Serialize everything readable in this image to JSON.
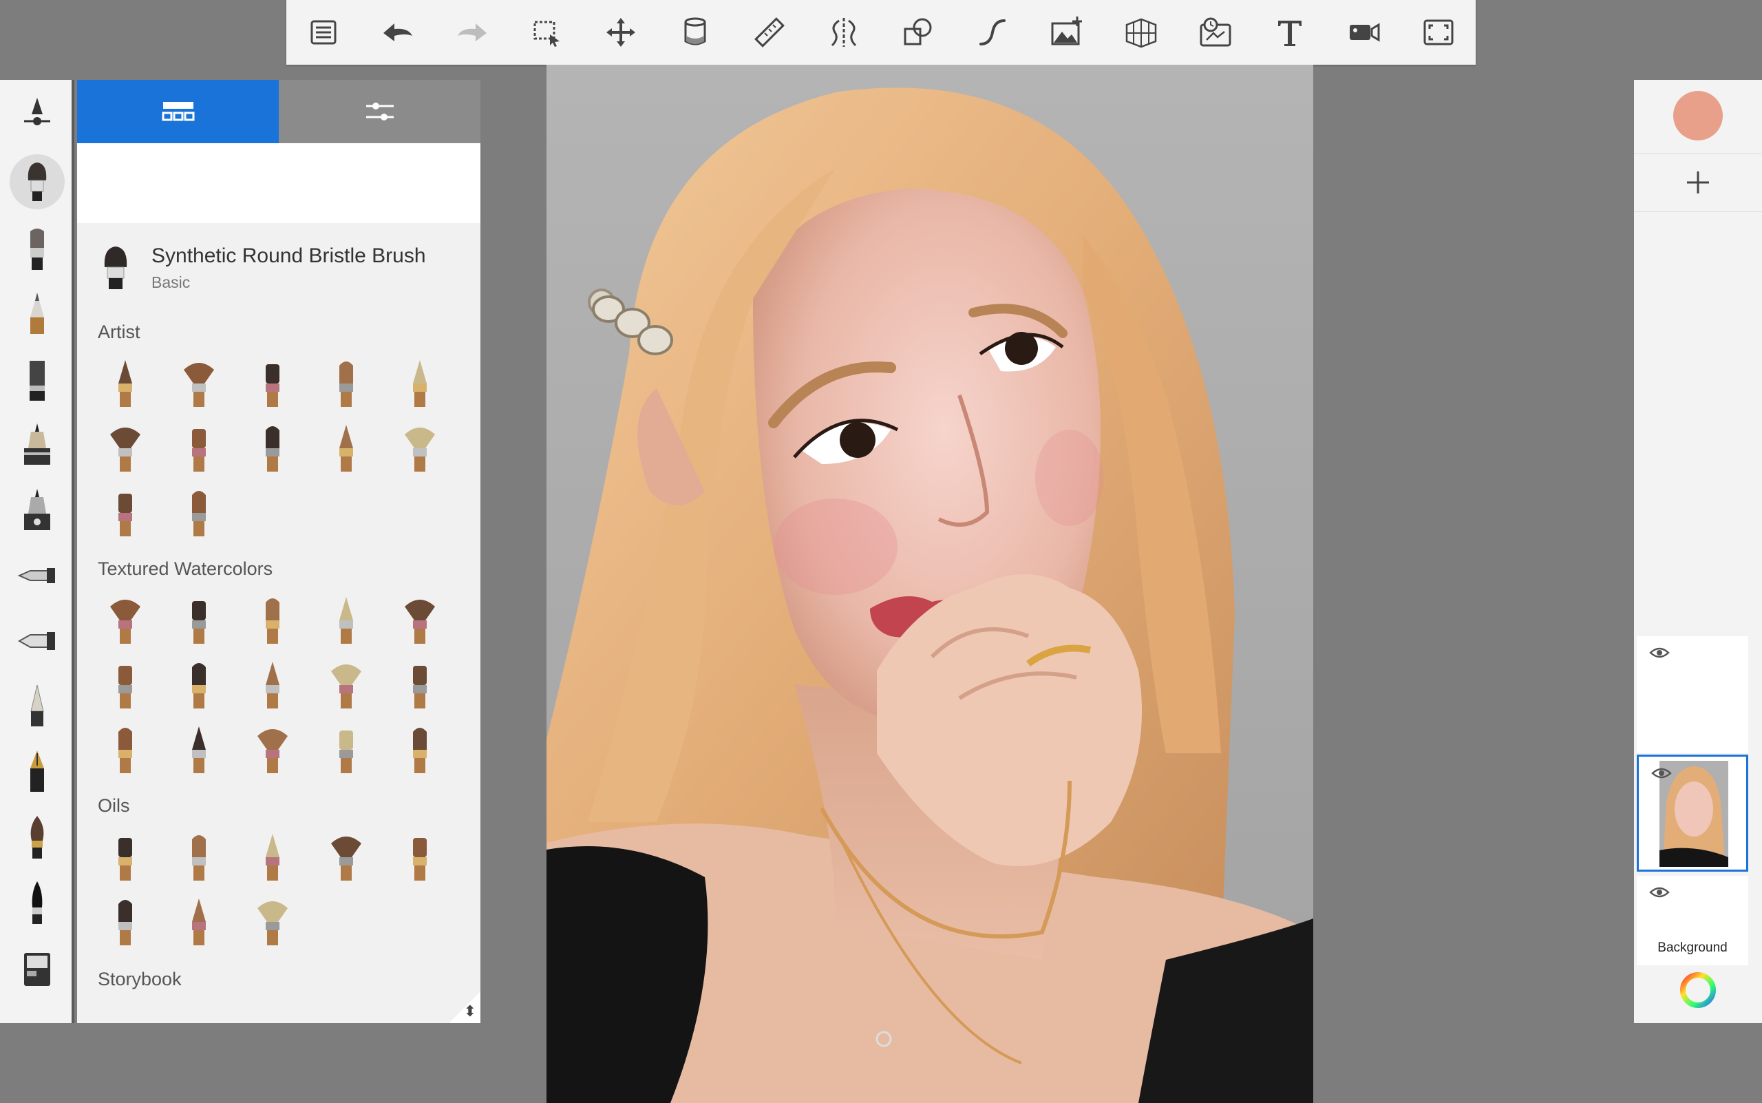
{
  "toolbar": {
    "buttons": [
      {
        "name": "menu-list-button",
        "icon": "list-icon"
      },
      {
        "name": "undo-button",
        "icon": "undo-icon"
      },
      {
        "name": "redo-button",
        "icon": "redo-icon"
      },
      {
        "name": "selection-button",
        "icon": "selection-icon"
      },
      {
        "name": "transform-button",
        "icon": "move-icon"
      },
      {
        "name": "fill-button",
        "icon": "paint-bucket-icon"
      },
      {
        "name": "ruler-button",
        "icon": "ruler-icon"
      },
      {
        "name": "symmetry-button",
        "icon": "symmetry-icon"
      },
      {
        "name": "shapes-button",
        "icon": "shapes-icon"
      },
      {
        "name": "stroke-button",
        "icon": "curve-icon"
      },
      {
        "name": "add-image-button",
        "icon": "image-add-icon"
      },
      {
        "name": "perspective-button",
        "icon": "perspective-grid-icon"
      },
      {
        "name": "time-lapse-button",
        "icon": "time-lapse-icon"
      },
      {
        "name": "text-button",
        "icon": "text-icon"
      },
      {
        "name": "record-button",
        "icon": "video-icon"
      },
      {
        "name": "fullscreen-button",
        "icon": "fullscreen-icon"
      }
    ]
  },
  "brush_panel": {
    "tabs": [
      {
        "name": "brush-library-tab",
        "icon": "brush-library-icon",
        "active": true
      },
      {
        "name": "brush-properties-tab",
        "icon": "sliders-icon",
        "active": false
      }
    ],
    "current_brush": {
      "name": "Synthetic Round Bristle Brush",
      "category": "Basic"
    },
    "sections": [
      {
        "title": "Artist",
        "count": 12
      },
      {
        "title": "Textured Watercolors",
        "count": 15
      },
      {
        "title": "Oils",
        "count": 8
      },
      {
        "title": "Storybook",
        "count": 0
      }
    ]
  },
  "right_panel": {
    "current_color": "#e8a08a",
    "layers": [
      {
        "label": "",
        "visible": true,
        "active": false
      },
      {
        "label": "",
        "visible": true,
        "active": true
      },
      {
        "label": "Background",
        "visible": true,
        "active": false
      }
    ]
  },
  "colors": {
    "accent": "#1a73d9",
    "toolbar_bg": "#f3f3f3",
    "workspace_bg": "#7d7d7d",
    "canvas_bg": "#a9a9a9"
  }
}
